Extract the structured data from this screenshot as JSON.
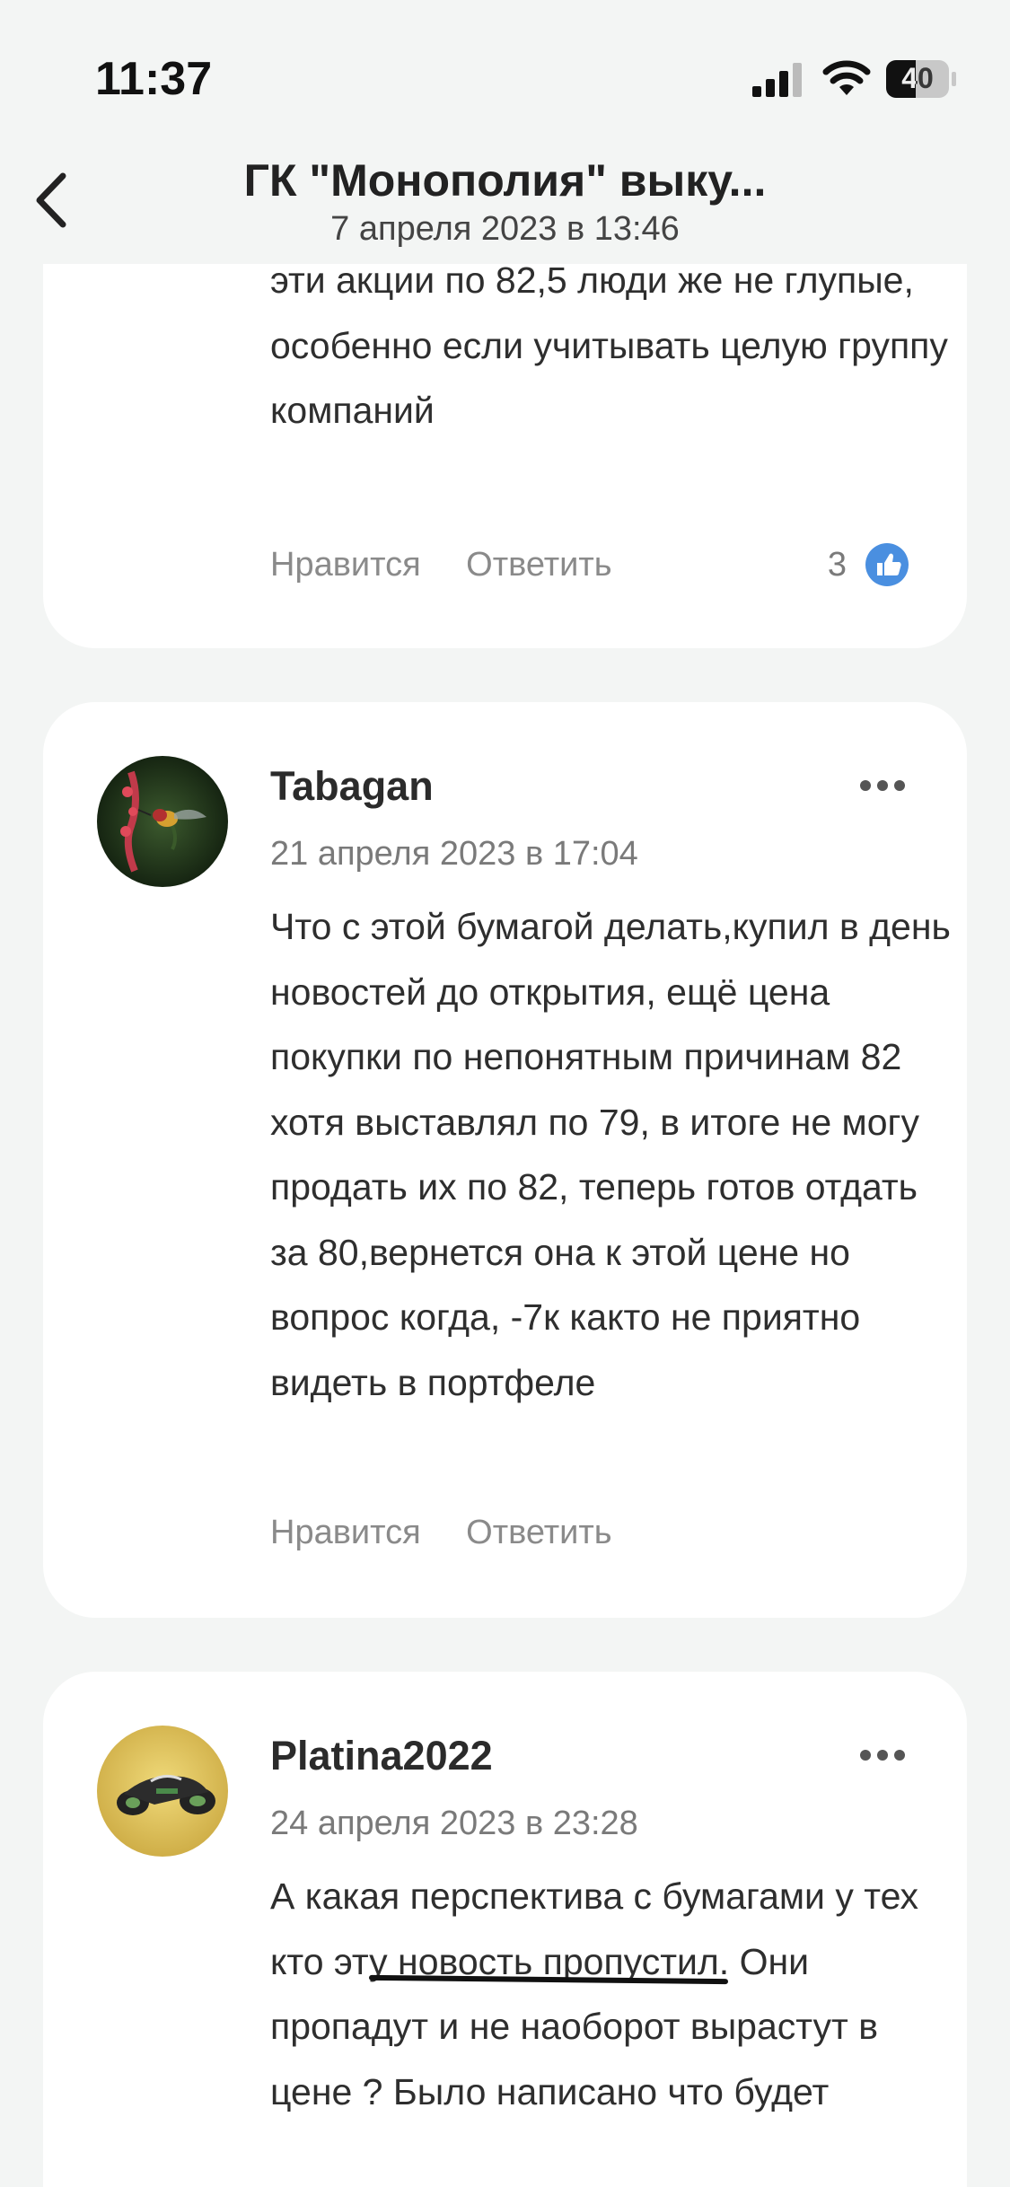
{
  "status_bar": {
    "time": "11:37",
    "battery": "40",
    "icons": [
      "signal-icon",
      "wifi-icon",
      "battery-icon"
    ]
  },
  "header": {
    "back_icon": "chevron-left-icon",
    "title": "ГК \"Монополия\" выку...",
    "subtitle": "7 апреля 2023 в 13:46"
  },
  "comments": [
    {
      "text": "эти акции по 82,5 люди же не глупые, особенно если учитывать целую группу компаний",
      "like_label": "Нравится",
      "reply_label": "Ответить",
      "likes": "3",
      "like_icon": "thumbs-up-icon"
    },
    {
      "author": "Tabagan",
      "date": "21 апреля 2023 в 17:04",
      "text": "Что с этой бумагой делать,купил в день новостей до открытия, ещё цена покупки по непонятным причинам 82 хотя выставлял по 79, в итоге не могу продать их по 82, теперь готов отдать за 80,вернется она к этой цене но вопрос когда, -7к както не приятно видеть в портфеле",
      "like_label": "Нравится",
      "reply_label": "Ответить",
      "avatar_icon": "hummingbird-avatar"
    },
    {
      "author": "Platina2022",
      "date": "24 апреля 2023 в 23:28",
      "text": "А какая перспектива с бумагами у тех кто эту новость пропустил. Они пропадут и не наоборот вырастут в цене ? Было написано что будет",
      "avatar_icon": "motorcycle-avatar"
    }
  ],
  "colors": {
    "background": "#f3f5f4",
    "card": "#ffffff",
    "like_blue": "#4a8fe0",
    "muted_text": "#8a8a8a"
  }
}
